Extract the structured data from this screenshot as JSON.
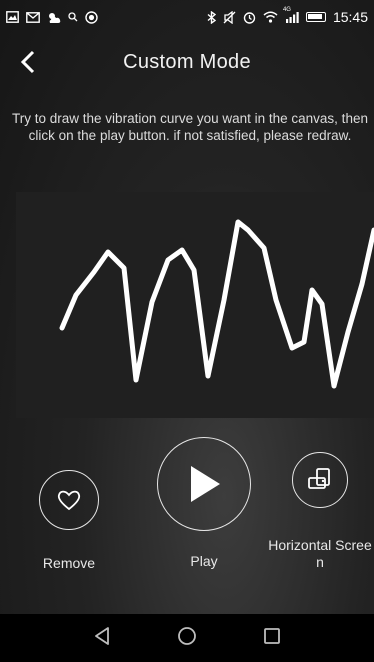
{
  "status_bar": {
    "time": "15:45",
    "left_icons": [
      "gallery-icon",
      "mail-icon",
      "weather-icon",
      "search-icon",
      "record-icon"
    ],
    "right_icons": [
      "bluetooth-icon",
      "mute-icon",
      "alarm-icon",
      "wifi-icon",
      "signal-icon",
      "battery-icon"
    ],
    "network_badge": "4G"
  },
  "header": {
    "title": "Custom Mode",
    "back_icon": "chevron-left-icon"
  },
  "instructions": "Try to draw the vibration curve you want in the canvas, then click on the play button. if not satisfied, please redraw.",
  "controls": {
    "remove": {
      "label": "Remove",
      "icon": "heart-outline-icon"
    },
    "play": {
      "label": "Play",
      "icon": "play-icon"
    },
    "horizontal": {
      "label": "Horizontal Scree\nn",
      "icon": "rotate-screen-icon"
    }
  },
  "nav": {
    "back_icon": "triangle-back-icon",
    "home_icon": "circle-home-icon",
    "recents_icon": "square-recents-icon"
  },
  "colors": {
    "accent": "#ffffff",
    "background": "#1c1c1c"
  }
}
